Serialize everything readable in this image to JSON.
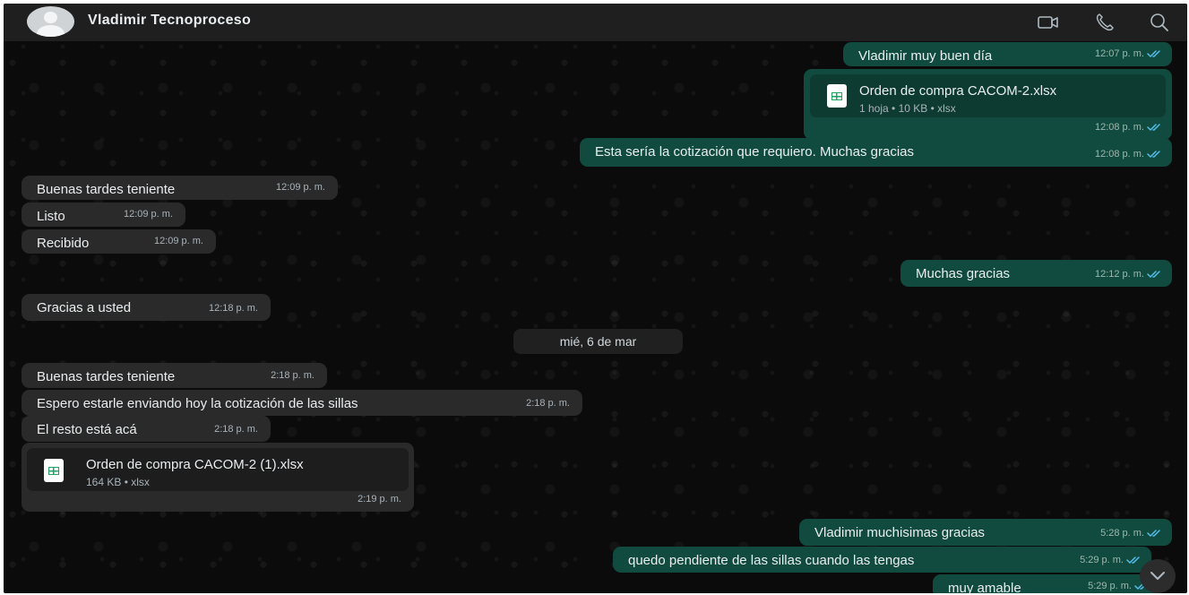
{
  "header": {
    "contact_name": "Vladimir Tecnoproceso",
    "icons": [
      "video-call-icon",
      "voice-call-icon",
      "search-icon"
    ]
  },
  "messages": [
    {
      "dir": "out",
      "text": "Vladimir muy buen día",
      "time": "12:07 p. m.",
      "read": true
    },
    {
      "dir": "out",
      "type": "file",
      "file_name": "Orden de compra CACOM-2.xlsx",
      "file_meta": "1 hoja • 10 KB • xlsx",
      "time": "12:08 p. m.",
      "read": true
    },
    {
      "dir": "out",
      "text": "Esta sería la cotización que requiero. Muchas gracias",
      "time": "12:08 p. m.",
      "read": true
    },
    {
      "dir": "in",
      "text": "Buenas tardes teniente",
      "time": "12:09 p. m."
    },
    {
      "dir": "in",
      "text": "Listo",
      "time": "12:09 p. m."
    },
    {
      "dir": "in",
      "text": "Recibido",
      "time": "12:09 p. m."
    },
    {
      "dir": "out",
      "text": "Muchas gracias",
      "time": "12:12 p. m.",
      "read": true
    },
    {
      "dir": "in",
      "text": "Gracias a usted",
      "time": "12:18 p. m."
    },
    {
      "dir": "in",
      "text": "Buenas tardes teniente",
      "time": "2:18 p. m."
    },
    {
      "dir": "in",
      "text": "Espero estarle enviando hoy la cotización de las sillas",
      "time": "2:18 p. m."
    },
    {
      "dir": "in",
      "text": "El resto está acá",
      "time": "2:18 p. m."
    },
    {
      "dir": "in",
      "type": "file",
      "file_name": "Orden de compra CACOM-2 (1).xlsx",
      "file_meta": "164 KB • xlsx",
      "time": "2:19 p. m."
    },
    {
      "dir": "out",
      "text": "Vladimir muchisimas gracias",
      "time": "5:28 p. m.",
      "read": true
    },
    {
      "dir": "out",
      "text": "quedo pendiente de las sillas cuando las tengas",
      "time": "5:29 p. m.",
      "read": true
    },
    {
      "dir": "out",
      "text": "muy amable",
      "time": "5:29 p. m.",
      "read": true
    }
  ],
  "date_separator": "mié, 6 de mar",
  "colors": {
    "background": "#0b0b0b",
    "header": "#1f1f1f",
    "incoming_bubble": "#2a2a2a",
    "outgoing_bubble": "#114b3f",
    "read_ticks": "#53bdeb"
  }
}
